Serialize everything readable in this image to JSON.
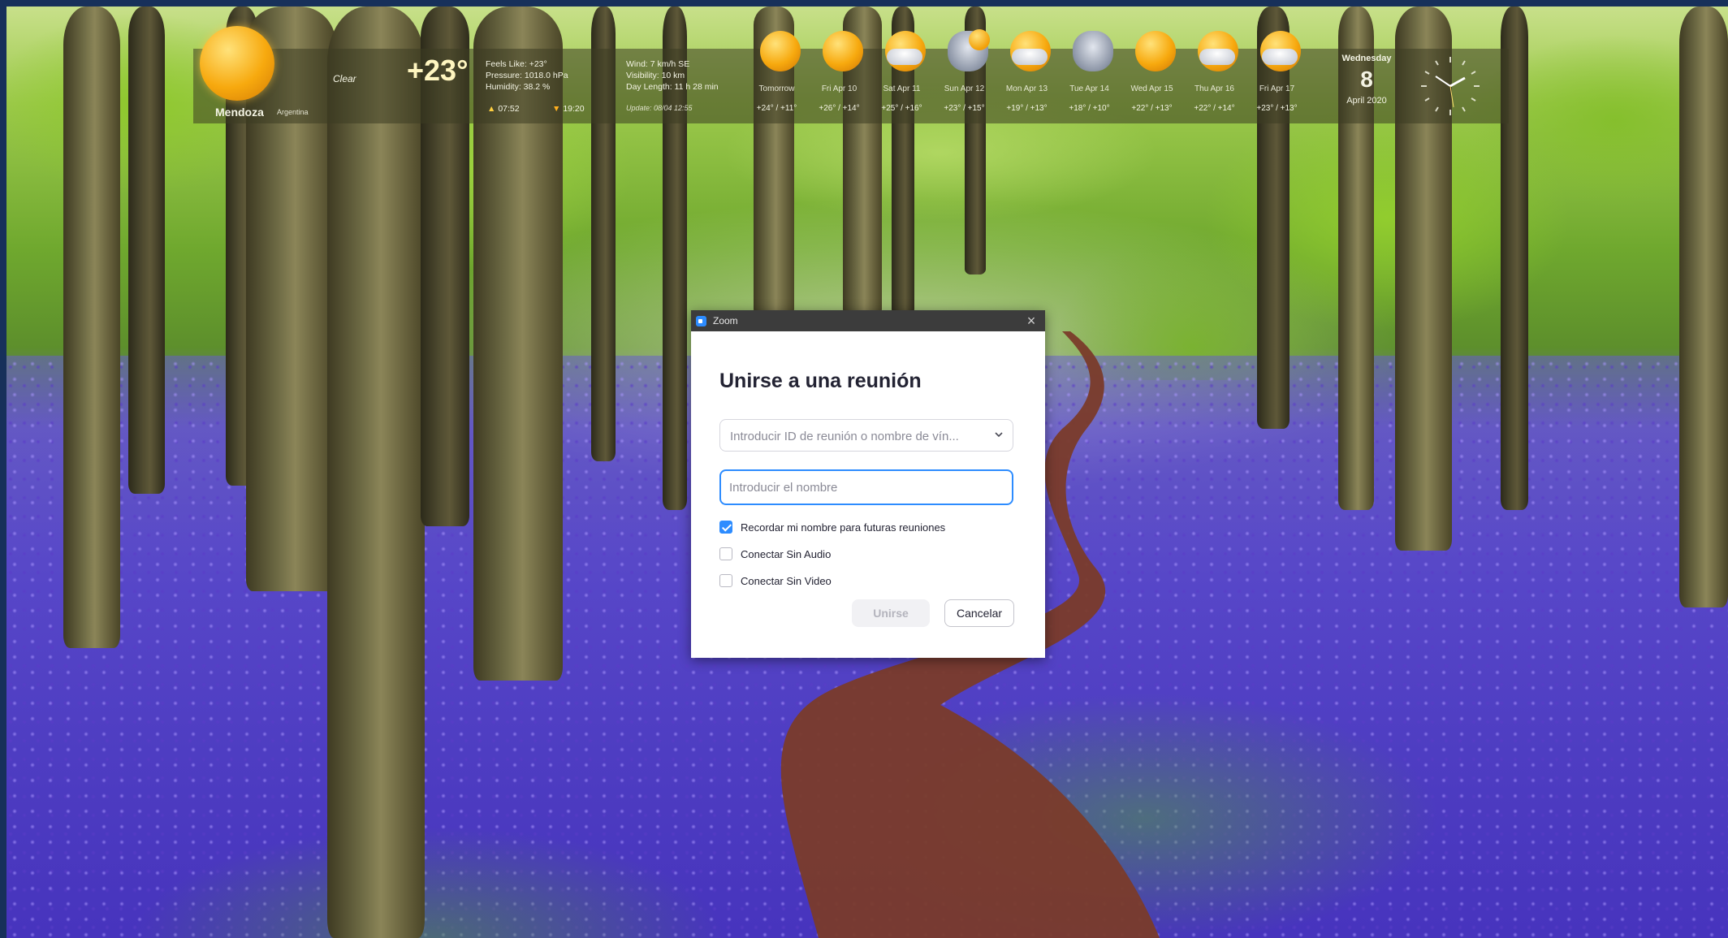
{
  "weather": {
    "city": "Mendoza",
    "country": "Argentina",
    "condition": "Clear",
    "temperature": "+23°",
    "feels_like": "Feels Like: +23°",
    "pressure": "Pressure: 1018.0 hPa",
    "humidity": "Humidity: 38.2 %",
    "sunrise": "07:52",
    "sunset": "19:20",
    "wind": "Wind: 7 km/h   SE",
    "visibility": "Visibility: 10 km",
    "day_length": "Day Length: 11 h 28 min",
    "updated": "Update: 08/04 12:55",
    "forecast": [
      {
        "day": "Tomorrow",
        "range": "+24° / +11°",
        "icon": "sun-icon"
      },
      {
        "day": "Fri Apr 10",
        "range": "+26° / +14°",
        "icon": "sun-icon"
      },
      {
        "day": "Sat Apr 11",
        "range": "+25° / +16°",
        "icon": "partly-cloudy-icon"
      },
      {
        "day": "Sun Apr 12",
        "range": "+23° / +15°",
        "icon": "cloudy-sun-icon"
      },
      {
        "day": "Mon Apr 13",
        "range": "+19° / +13°",
        "icon": "partly-cloudy-icon"
      },
      {
        "day": "Tue Apr 14",
        "range": "+18° / +10°",
        "icon": "cloud-icon"
      },
      {
        "day": "Wed Apr 15",
        "range": "+22° / +13°",
        "icon": "sun-icon"
      },
      {
        "day": "Thu Apr 16",
        "range": "+22° / +14°",
        "icon": "partly-cloudy-icon"
      },
      {
        "day": "Fri Apr 17",
        "range": "+23° / +13°",
        "icon": "partly-cloudy-icon"
      }
    ]
  },
  "date": {
    "weekday": "Wednesday",
    "day": "8",
    "month_year": "April 2020"
  },
  "zoom": {
    "title": "Zoom",
    "heading": "Unirse a una reunión",
    "meeting_placeholder": "Introducir ID de reunión o nombre de vín...",
    "name_placeholder": "Introducir el nombre",
    "options": [
      {
        "label": "Recordar mi nombre para futuras reuniones",
        "checked": true
      },
      {
        "label": "Conectar Sin Audio",
        "checked": false
      },
      {
        "label": "Conectar Sin Video",
        "checked": false
      }
    ],
    "join_label": "Unirse",
    "cancel_label": "Cancelar"
  },
  "colors": {
    "zoom_blue": "#2d8cff",
    "titlebar": "#3c3c3c",
    "disabled_button": "#f1f1f4"
  }
}
